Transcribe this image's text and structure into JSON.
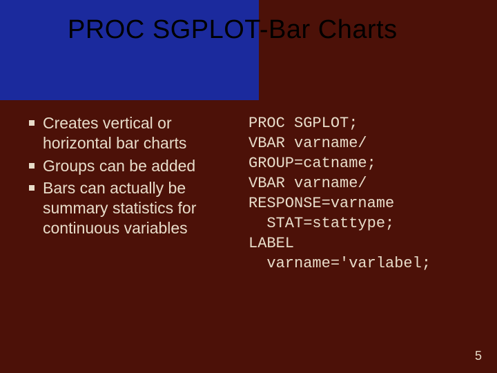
{
  "title": "PROC SGPLOT-Bar Charts",
  "bullets": {
    "b1": "Creates vertical or horizontal bar charts",
    "b2": "Groups can be added",
    "b3": "Bars can actually be summary statistics for continuous variables"
  },
  "code": {
    "l1": "PROC SGPLOT;",
    "l2": "VBAR varname/",
    "l3": "GROUP=catname;",
    "l4": "VBAR varname/",
    "l5": "RESPONSE=varname",
    "l6": "  STAT=stattype;",
    "l7": "LABEL",
    "l8": "  varname='varlabel;"
  },
  "page_number": "5"
}
